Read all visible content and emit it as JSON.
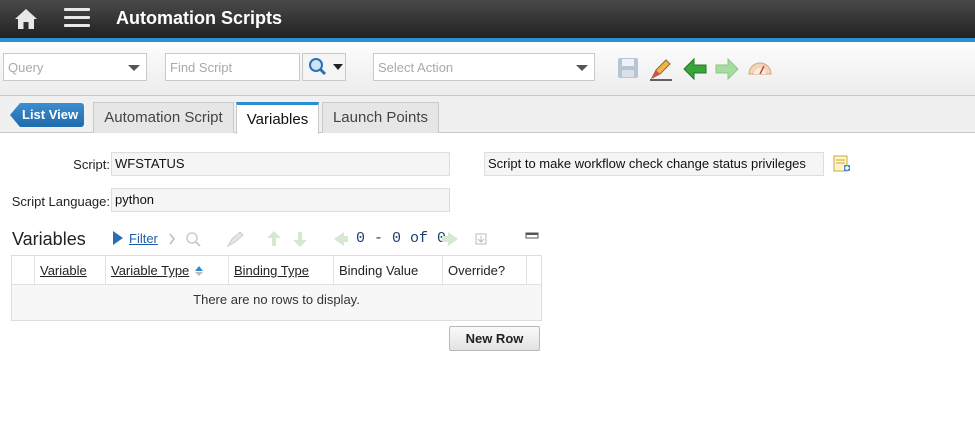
{
  "header": {
    "title": "Automation Scripts"
  },
  "toolbar": {
    "query_placeholder": "Query",
    "find_placeholder": "Find Script",
    "action_placeholder": "Select Action"
  },
  "tabs": {
    "list_view": "List View",
    "items": [
      {
        "label": "Automation Script",
        "active": false
      },
      {
        "label": "Variables",
        "active": true
      },
      {
        "label": "Launch Points",
        "active": false
      }
    ]
  },
  "form": {
    "script_label": "Script:",
    "script_value": "WFSTATUS",
    "description_value": "Script to make workflow check change status privileges",
    "language_label": "Script Language:",
    "language_value": "python"
  },
  "variables": {
    "title": "Variables",
    "filter_label": "Filter",
    "pager": "0 - 0 of 0",
    "columns": [
      "Variable",
      "Variable Type",
      "Binding Type",
      "Binding Value",
      "Override?"
    ],
    "empty_message": "There are no rows to display.",
    "new_row_label": "New Row"
  },
  "colors": {
    "accent": "#2a8fd0",
    "header_bg": "#2b2b2b",
    "link": "#1f5fa8"
  }
}
